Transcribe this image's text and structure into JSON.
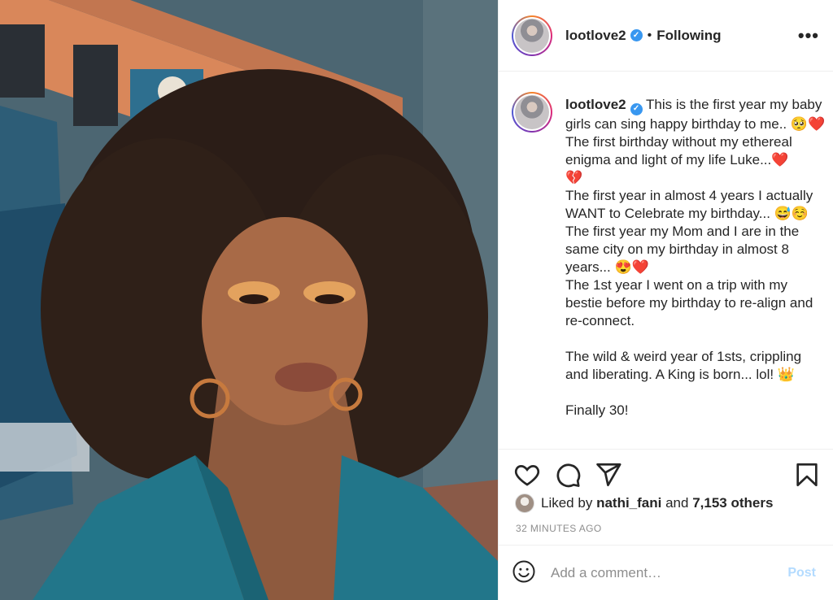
{
  "post": {
    "username": "lootlove2",
    "verified_icon": "verified-badge-icon",
    "separator": "•",
    "follow_state": "Following",
    "more_icon": "more-options-icon",
    "more_glyph": "•••"
  },
  "caption": {
    "username": "lootlove2",
    "text": "This is the first year my baby girls can sing happy birthday to me.. 🥺❤️\nThe first birthday without my ethereal enigma and light of my life Luke...❤️\n💔\nThe first year in almost 4 years I actually WANT to Celebrate my birthday... 😅☺️\nThe first year my Mom and I are in the same city on my birthday in almost 8 years... 😍❤️\nThe 1st year I went on a trip with my bestie before my birthday to re-align and re-connect.\n\nThe wild & weird year of 1sts, crippling and liberating. A King is born... lol! 👑\n\nFinally 30!"
  },
  "actions": {
    "icons": [
      "heart-icon",
      "comment-icon",
      "share-icon",
      "bookmark-icon"
    ],
    "liked_by_prefix": "Liked by",
    "liked_by_user": "nathi_fani",
    "liked_by_and": "and",
    "liked_by_count": "7,153 others",
    "timestamp": "32 MINUTES AGO"
  },
  "comment": {
    "emoji_icon": "emoji-icon",
    "placeholder": "Add a comment…",
    "post_label": "Post"
  },
  "colors": {
    "verified_blue": "#3897f0",
    "post_disabled": "#b3dbff",
    "muted_text": "#8e8e8e"
  }
}
